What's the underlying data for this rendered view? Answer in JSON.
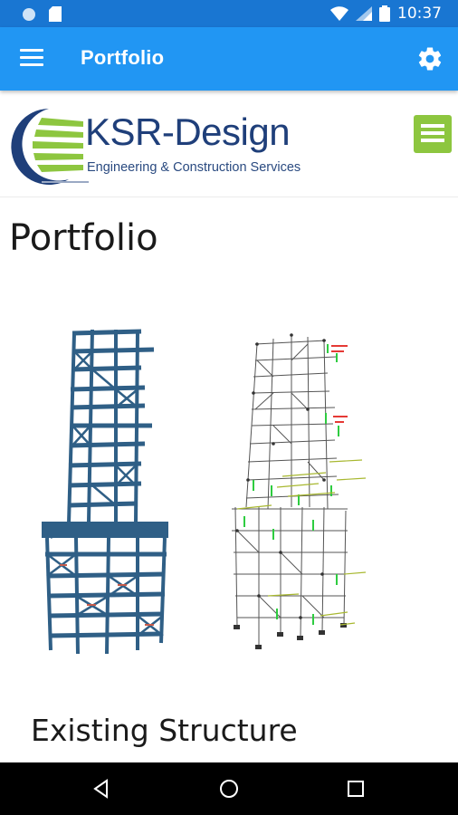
{
  "status_bar": {
    "time": "10:37",
    "icons": [
      "notification-dot-icon",
      "sd-card-icon",
      "wifi-icon",
      "cell-signal-icon",
      "battery-icon"
    ]
  },
  "appbar": {
    "title": "Portfolio",
    "color": "#2196f3",
    "status_color": "#1976d2",
    "icons": [
      "hamburger-menu-icon",
      "gear-icon"
    ]
  },
  "site": {
    "brand": "KSR-Design",
    "tagline": "Engineering & Construction Services",
    "menu_color": "#8dc63f",
    "brand_color": "#1f3f7a"
  },
  "page": {
    "title": "Portfolio",
    "section_heading": "Existing Structure"
  },
  "nav": {
    "icons": [
      "back-icon",
      "home-icon",
      "recents-icon"
    ]
  }
}
